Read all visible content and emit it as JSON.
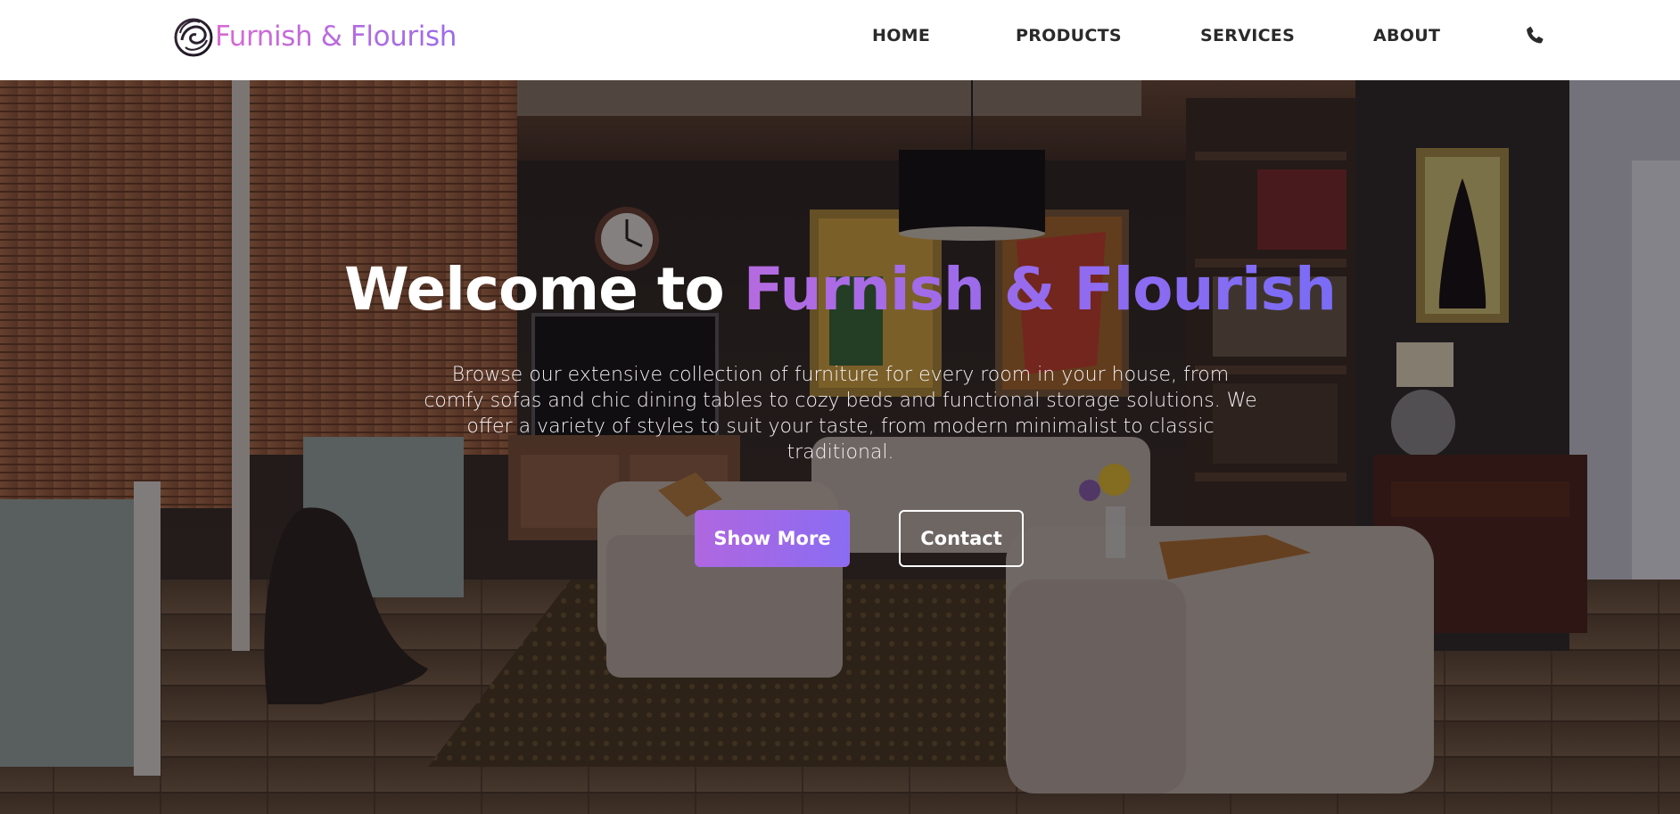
{
  "brand": {
    "name": "Furnish & Flourish",
    "logo_icon": "swirl-logo-icon",
    "gradient": [
      "#d96ad3",
      "#9b6bea"
    ]
  },
  "nav": {
    "items": [
      {
        "label": "HOME"
      },
      {
        "label": "PRODUCTS"
      },
      {
        "label": "SERVICES"
      },
      {
        "label": "ABOUT"
      }
    ],
    "phone_icon": "phone-icon"
  },
  "hero": {
    "title_prefix": "Welcome to ",
    "title_accent": "Furnish & Flourish",
    "description": "Browse our extensive collection of furniture for every room in your house, from comfy sofas and chic dining tables to cozy beds and functional storage solutions. We offer a variety of styles to suit your taste, from modern minimalist to classic traditional.",
    "primary_button": "Show More",
    "secondary_button": "Contact",
    "accent_colors": [
      "#b067e0",
      "#8a6cf2"
    ]
  }
}
